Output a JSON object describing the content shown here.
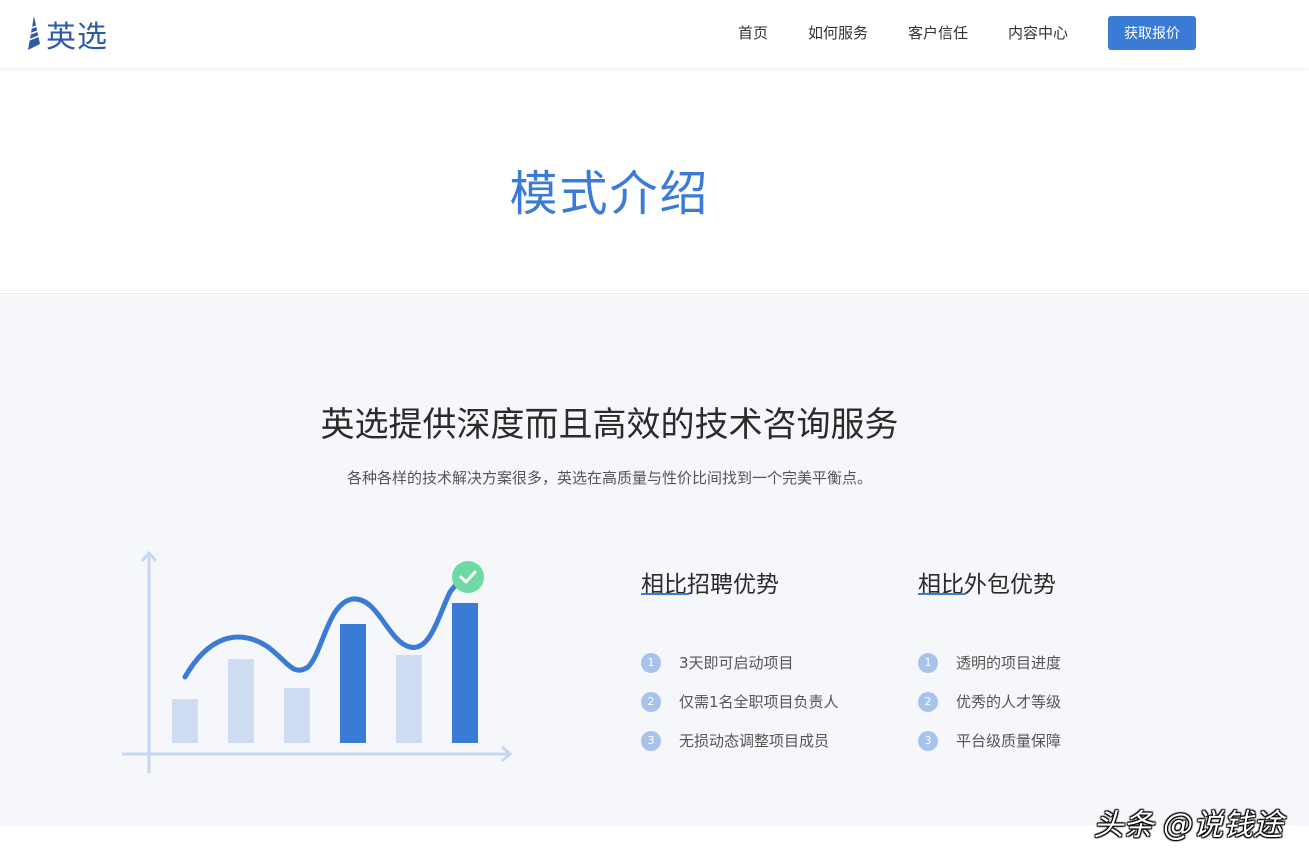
{
  "header": {
    "logo_text": "英选",
    "nav": [
      {
        "label": "首页"
      },
      {
        "label": "如何服务"
      },
      {
        "label": "客户信任"
      },
      {
        "label": "内容中心"
      }
    ],
    "cta_label": "获取报价",
    "accent_color": "#3a7bd5"
  },
  "hero": {
    "title": "模式介绍"
  },
  "section": {
    "title": "英选提供深度而且高效的技术咨询服务",
    "subtitle": "各种各样的技术解决方案很多，英选在高质量与性价比间找到一个完美平衡点。",
    "chart_icon": "growth-chart-illustration",
    "columns": [
      {
        "title": "相比招聘优势",
        "items": [
          {
            "num": "1",
            "text": "3天即可启动项目"
          },
          {
            "num": "2",
            "text": "仅需1名全职项目负责人"
          },
          {
            "num": "3",
            "text": "无损动态调整项目成员"
          }
        ]
      },
      {
        "title": "相比外包优势",
        "items": [
          {
            "num": "1",
            "text": "透明的项目进度"
          },
          {
            "num": "2",
            "text": "优秀的人才等级"
          },
          {
            "num": "3",
            "text": "平台级质量保障"
          }
        ]
      }
    ]
  },
  "watermark": "头条 @说钱途"
}
